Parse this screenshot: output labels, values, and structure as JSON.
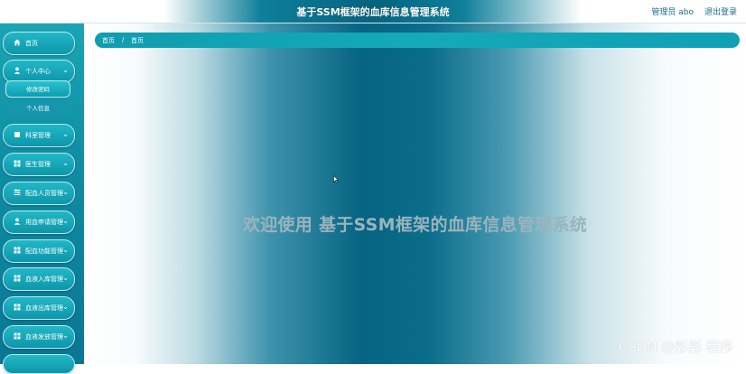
{
  "header": {
    "title": "基于SSM框架的血库信息管理系统",
    "user_label": "管理员 abo",
    "logout_label": "退出登录"
  },
  "sidebar": {
    "items": [
      {
        "label": "首页",
        "icon": "home-icon"
      },
      {
        "label": "个人中心",
        "icon": "user-icon"
      },
      {
        "label": "科室管理",
        "icon": "box-icon"
      },
      {
        "label": "医生管理",
        "icon": "grid-icon"
      },
      {
        "label": "配血人员管理",
        "icon": "sliders-icon"
      },
      {
        "label": "用血申请管理",
        "icon": "user-icon"
      },
      {
        "label": "配血功能管理",
        "icon": "grid-icon"
      },
      {
        "label": "血液入库管理",
        "icon": "grid-icon"
      },
      {
        "label": "血液出库管理",
        "icon": "grid-icon"
      },
      {
        "label": "血液发放管理",
        "icon": "grid-icon"
      }
    ],
    "submenu": [
      {
        "label": "修改密码"
      },
      {
        "label": "个人信息"
      }
    ]
  },
  "breadcrumb": {
    "home": "首页",
    "separator": "/",
    "current": "首页"
  },
  "main": {
    "welcome": "欢迎使用 基于SSM框架的血库信息管理系统"
  },
  "watermark": "CSDN @彤彤  程序",
  "colors": {
    "accent": "#0f9db0",
    "deep": "#05637f"
  }
}
